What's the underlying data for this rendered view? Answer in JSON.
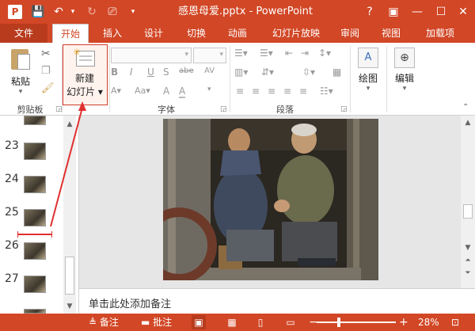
{
  "titlebar": {
    "logo": "P",
    "title": "感恩母爱.pptx - PowerPoint",
    "help": "?",
    "ribbon_display": "▣",
    "minimize": "—",
    "restore": "☐",
    "close": "✕"
  },
  "tabs": [
    {
      "label": "文件"
    },
    {
      "label": "开始"
    },
    {
      "label": "插入"
    },
    {
      "label": "设计"
    },
    {
      "label": "切换"
    },
    {
      "label": "动画"
    },
    {
      "label": "幻灯片放映"
    },
    {
      "label": "审阅"
    },
    {
      "label": "视图"
    },
    {
      "label": "加载项"
    }
  ],
  "ribbon": {
    "paste_label": "粘贴",
    "new_slide_line1": "新建",
    "new_slide_line2": "幻灯片",
    "drawing_label": "绘图",
    "editing_label": "编辑",
    "groups": {
      "clipboard": "剪贴板",
      "font": "字体",
      "paragraph": "段落"
    },
    "font_icons": {
      "bold": "B",
      "italic": "I",
      "underline": "U",
      "strike": "S",
      "shadow": "abe",
      "char_spacing": "AV",
      "change_case": "Aa",
      "clear_fmt": "A",
      "grow": "A",
      "shrink": "A",
      "font_color": "A"
    }
  },
  "slides": [
    {
      "number": ""
    },
    {
      "number": "23"
    },
    {
      "number": "24"
    },
    {
      "number": "25"
    },
    {
      "number": "26"
    },
    {
      "number": "27"
    },
    {
      "number": ""
    }
  ],
  "notes_placeholder": "单击此处添加备注",
  "statusbar": {
    "notes": "备注",
    "comments": "批注",
    "zoom_minus": "−",
    "zoom_plus": "+",
    "zoom_level": "28%",
    "zoom_fraction": 0.28
  },
  "colors": {
    "accent": "#d24726",
    "callout": "#e03030"
  }
}
